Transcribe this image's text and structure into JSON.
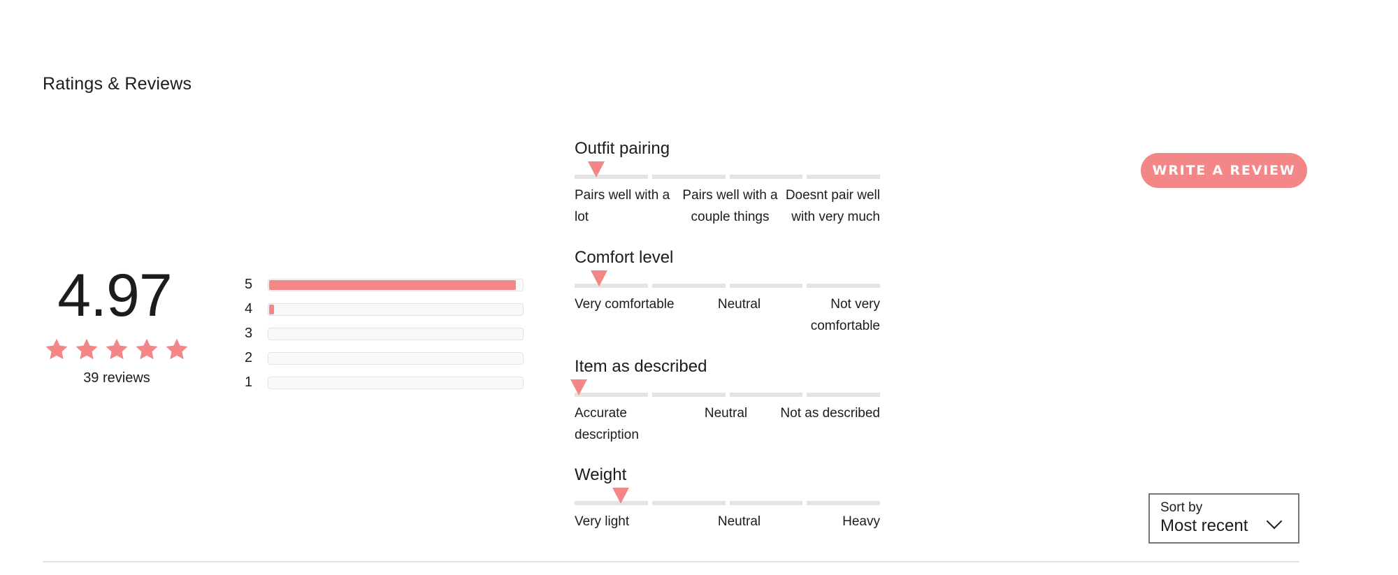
{
  "header": {
    "title": "Ratings & Reviews"
  },
  "summary": {
    "average": "4.97",
    "stars_filled": 5,
    "stars_total": 5,
    "review_count_label": "39 reviews"
  },
  "histogram": [
    {
      "label": "5",
      "fraction": 0.974
    },
    {
      "label": "4",
      "fraction": 0.026
    },
    {
      "label": "3",
      "fraction": 0
    },
    {
      "label": "2",
      "fraction": 0
    },
    {
      "label": "1",
      "fraction": 0
    }
  ],
  "attributes": [
    {
      "title": "Outfit pairing",
      "value": 0.07,
      "labels": [
        "Pairs well with a lot",
        "Pairs well with a couple things",
        "Doesnt pair well with very much"
      ]
    },
    {
      "title": "Comfort level",
      "value": 0.08,
      "labels": [
        "Very comfortable",
        "Neutral",
        "Not very comfortable"
      ]
    },
    {
      "title": "Item as described",
      "value": 0.0,
      "labels": [
        "Accurate description",
        "Neutral",
        "Not as described"
      ]
    },
    {
      "title": "Weight",
      "value": 0.15,
      "labels": [
        "Very light",
        "Neutral",
        "Heavy"
      ]
    }
  ],
  "actions": {
    "write_review_label": "WRITE A REVIEW"
  },
  "sort": {
    "label": "Sort by",
    "selected": "Most recent"
  },
  "colors": {
    "accent": "#f38787",
    "track": "#e4e4e4",
    "text": "#1c1c1c"
  }
}
